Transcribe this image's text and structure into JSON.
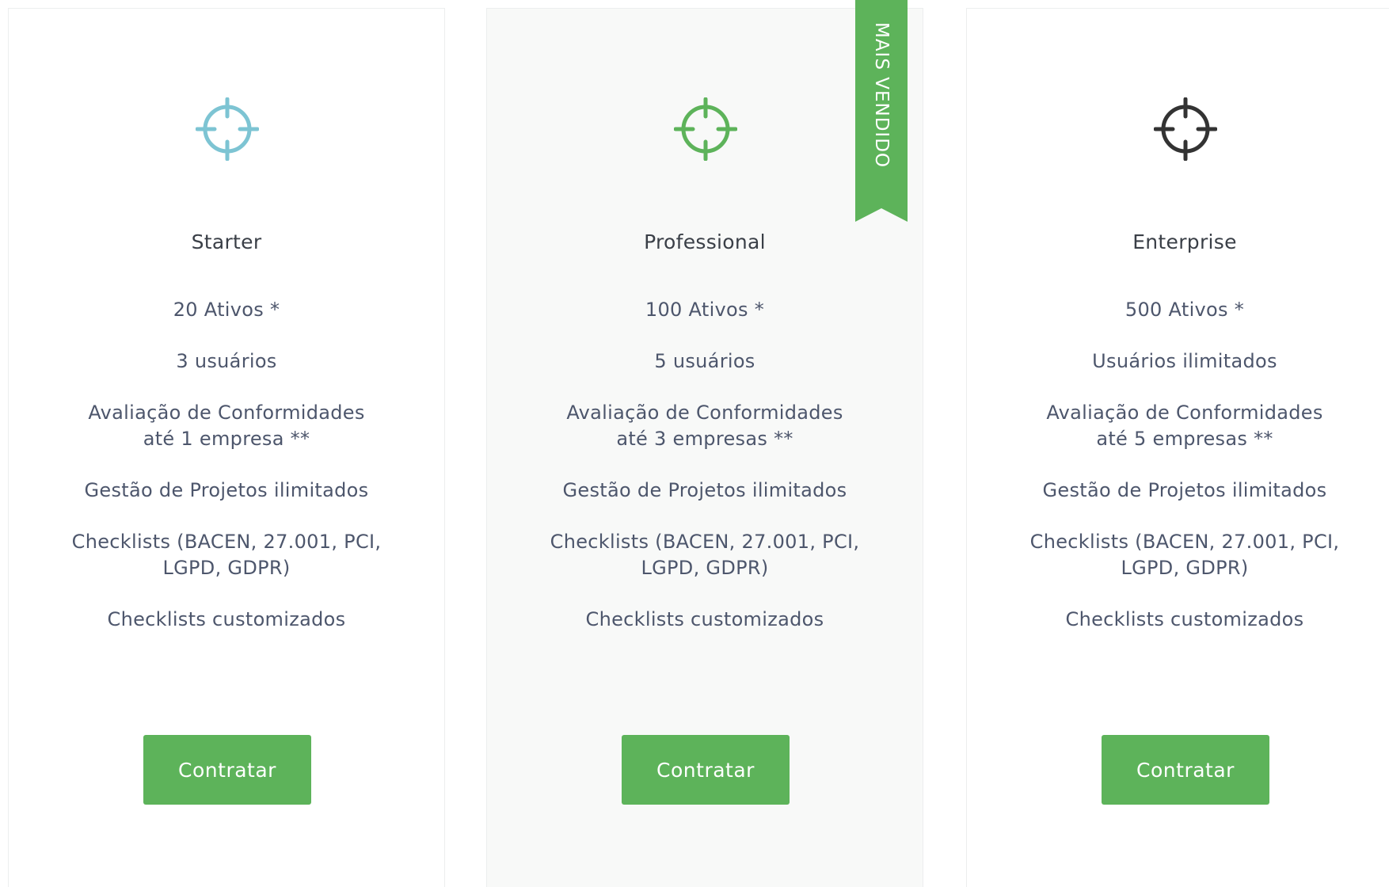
{
  "colors": {
    "accent_green": "#5db35a",
    "starter_icon": "#7dc4d3",
    "professional_icon": "#5db35a",
    "enterprise_icon": "#333333",
    "highlight_card_bg": "#f8f9f8"
  },
  "ribbon": {
    "label": "MAIS VENDIDO"
  },
  "plans": [
    {
      "icon": "crosshair-icon",
      "name": "Starter",
      "features": [
        "20 Ativos *",
        "3 usuários",
        "Avaliação de Conformidades",
        "até 1 empresa **",
        "Gestão de Projetos ilimitados",
        "Checklists (BACEN, 27.001, PCI,",
        "LGPD, GDPR)",
        "Checklists customizados"
      ],
      "button": "Contratar"
    },
    {
      "icon": "crosshair-icon",
      "name": "Professional",
      "features": [
        "100 Ativos *",
        "5 usuários",
        "Avaliação de Conformidades",
        "até 3 empresas **",
        "Gestão de Projetos ilimitados",
        "Checklists (BACEN, 27.001, PCI,",
        "LGPD, GDPR)",
        "Checklists customizados"
      ],
      "button": "Contratar"
    },
    {
      "icon": "crosshair-icon",
      "name": "Enterprise",
      "features": [
        "500 Ativos *",
        "Usuários ilimitados",
        "Avaliação de Conformidades",
        "até 5 empresas **",
        "Gestão de Projetos ilimitados",
        "Checklists (BACEN, 27.001, PCI,",
        "LGPD, GDPR)",
        "Checklists customizados"
      ],
      "button": "Contratar"
    }
  ]
}
